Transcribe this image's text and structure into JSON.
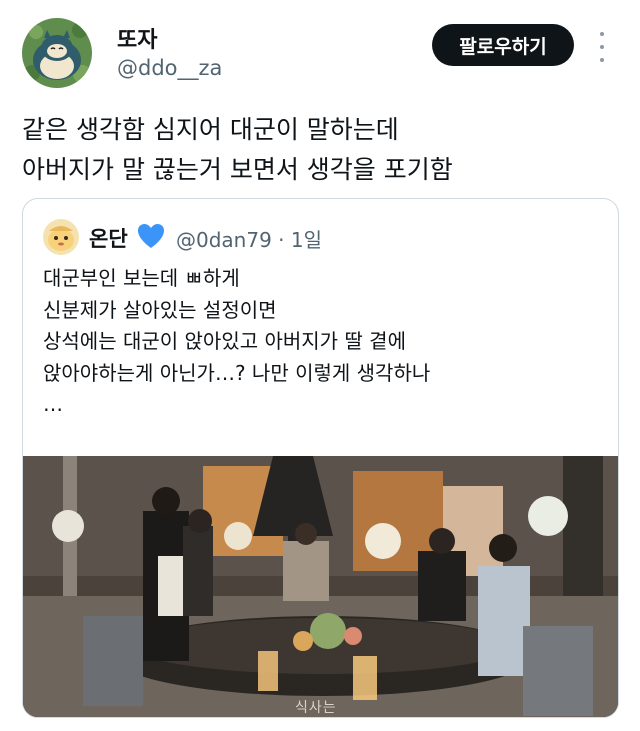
{
  "author": {
    "display_name": "또자",
    "handle": "@ddo__za",
    "avatar_icon": "snorlax-avatar"
  },
  "actions": {
    "follow_label": "팔로우하기",
    "more_icon": "more-vertical-icon"
  },
  "tweet": {
    "text": "같은 생각함 심지어 대군이 말하는데\n아버지가 말 끊는거 보면서 생각을 포기함"
  },
  "quote": {
    "display_name": "온단",
    "verified_icon": "blue-heart-icon",
    "handle": "@0dan79",
    "age": "· 1일",
    "text": "대군부인 보는데 ㅃ하게\n신분제가 살아있는 설정이면\n상석에는 대군이 앉아있고 아버지가 딸 곁에\n앉아야하는게 아닌가…? 나만 이렇게 생각하나\n…",
    "media_caption": "식사는"
  },
  "colors": {
    "text": "#0f1419",
    "secondary": "#536471",
    "border": "#cfd9de",
    "button_bg": "#0f1419",
    "heart": "#3b94f7"
  }
}
